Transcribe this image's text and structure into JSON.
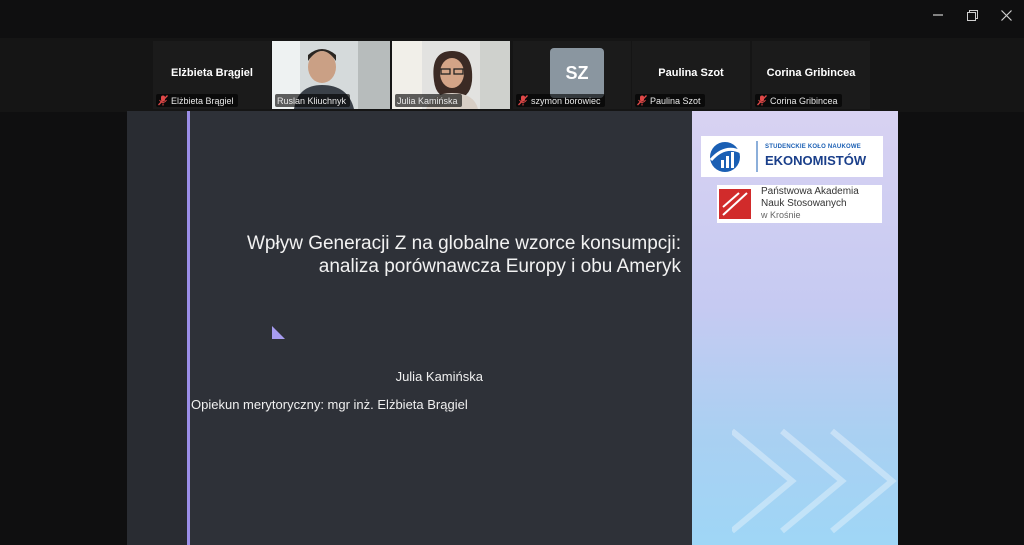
{
  "window": {
    "controls": [
      "minimize",
      "restore",
      "close"
    ]
  },
  "participants": [
    {
      "display_name": "Elżbieta Brągiel",
      "label": "Elżbieta Brągiel",
      "muted": true,
      "video": false
    },
    {
      "label": "Ruslan Kliuchnyk",
      "muted": false,
      "video": true
    },
    {
      "label": "Julia Kamińska",
      "muted": false,
      "video": true,
      "active_speaker": true
    },
    {
      "initials": "SZ",
      "label": "szymon borowiec",
      "muted": true,
      "video": false
    },
    {
      "display_name": "Paulina Szot",
      "label": "Paulina Szot",
      "muted": true,
      "video": false
    },
    {
      "display_name": "Corina Gribincea",
      "label": "Corina Gribincea",
      "muted": true,
      "video": false
    }
  ],
  "slide": {
    "title_line1": "Wpływ Generacji Z na globalne wzorce konsumpcji:",
    "title_line2": "analiza porównawcza Europy i obu Ameryk",
    "author": "Julia Kamińska",
    "supervisor": "Opiekun merytoryczny: mgr inż. Elżbieta Brągiel",
    "logo1_line1": "STUDENCKIE KOŁO NAUKOWE",
    "logo1_line2": "EKONOMISTÓW",
    "logo2_line1": "Państwowa Akademia",
    "logo2_line2": "Nauk Stosowanych",
    "logo2_line3": "w Krośnie"
  },
  "colors": {
    "accent_purple": "#9b8fe8",
    "active_speaker": "#2ecc71",
    "muted_mic": "#e04848",
    "logo_blue": "#1a5fb4",
    "logo_red": "#d12b2b"
  },
  "icons": [
    "minimize-icon",
    "restore-icon",
    "close-icon",
    "muted-mic-icon",
    "triangle-accent-icon"
  ]
}
